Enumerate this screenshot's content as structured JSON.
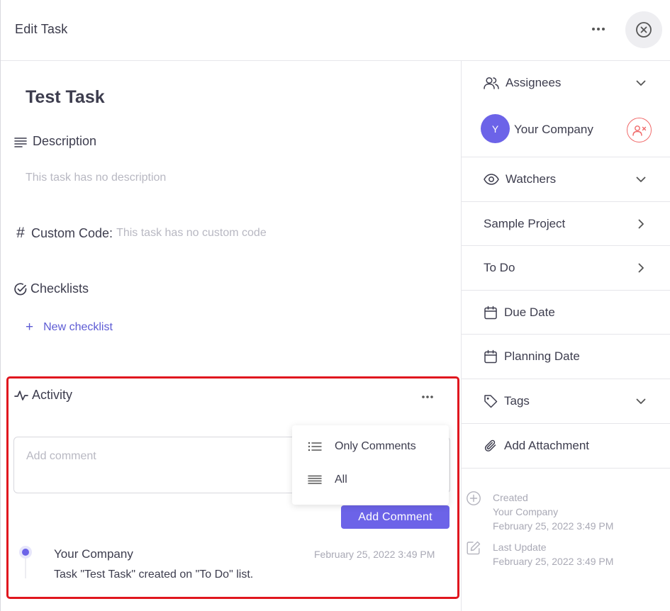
{
  "header": {
    "title": "Edit Task"
  },
  "task": {
    "title": "Test Task"
  },
  "description": {
    "label": "Description",
    "empty": "This task has no description"
  },
  "custom_code": {
    "label": "Custom Code:",
    "empty": "This task has no custom code"
  },
  "checklists": {
    "label": "Checklists",
    "new_label": "New checklist",
    "new_icon": "+"
  },
  "activity": {
    "label": "Activity",
    "comment_placeholder": "Add comment",
    "add_comment_label": "Add Comment",
    "filter_menu": [
      {
        "label": "Only Comments"
      },
      {
        "label": "All"
      }
    ],
    "entries": [
      {
        "user": "Your Company",
        "time": "February 25, 2022 3:49 PM",
        "text": "Task \"Test Task\" created on \"To Do\" list."
      }
    ]
  },
  "sidebar": {
    "assignees_label": "Assignees",
    "assignee": {
      "initial": "Y",
      "name": "Your Company"
    },
    "watchers_label": "Watchers",
    "project_label": "Sample Project",
    "status_label": "To Do",
    "due_date_label": "Due Date",
    "planning_date_label": "Planning Date",
    "tags_label": "Tags",
    "attachment_label": "Add Attachment",
    "created": {
      "label": "Created",
      "by": "Your Company",
      "time": "February 25, 2022 3:49 PM"
    },
    "updated": {
      "label": "Last Update",
      "time": "February 25, 2022 3:49 PM"
    }
  },
  "colors": {
    "accent": "#6c63e8",
    "highlight_border": "#e0161e",
    "danger": "#f06a6a",
    "muted_text": "#b8b8c2"
  }
}
